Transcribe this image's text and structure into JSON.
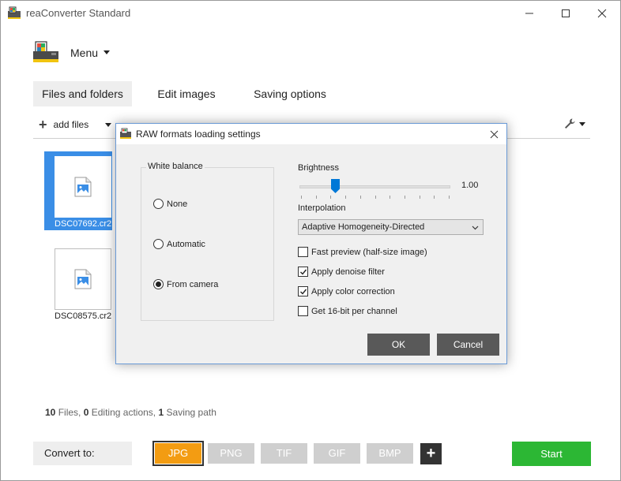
{
  "window": {
    "title": "reaConverter Standard"
  },
  "menu": {
    "label": "Menu"
  },
  "tabs": [
    {
      "label": "Files and folders"
    },
    {
      "label": "Edit images"
    },
    {
      "label": "Saving options"
    }
  ],
  "toolbar": {
    "add_files_label": "add files",
    "settings_icon": "wrench-icon"
  },
  "files": [
    {
      "name": "DSC07692.cr2",
      "selected": true
    },
    {
      "name": "DSC08575.cr2",
      "selected": false
    }
  ],
  "status": {
    "files_count": "10",
    "files_label": "Files,",
    "editing_count": "0",
    "editing_label": "Editing actions,",
    "saving_count": "1",
    "saving_label": "Saving path"
  },
  "bottom": {
    "convert_to_label": "Convert to:",
    "formats": [
      "JPG",
      "PNG",
      "TIF",
      "GIF",
      "BMP"
    ],
    "selected_format": "JPG",
    "add_format_label": "+",
    "start_label": "Start"
  },
  "dialog": {
    "title": "RAW formats loading settings",
    "white_balance": {
      "legend": "White balance",
      "options": [
        "None",
        "Automatic",
        "From camera"
      ],
      "selected": "From camera"
    },
    "brightness": {
      "label": "Brightness",
      "value": "1.00",
      "position": 0.23
    },
    "interpolation": {
      "label": "Interpolation",
      "value": "Adaptive Homogeneity-Directed"
    },
    "checkboxes": [
      {
        "label": "Fast preview (half-size image)",
        "checked": false
      },
      {
        "label": "Apply denoise filter",
        "checked": true
      },
      {
        "label": "Apply color correction",
        "checked": true
      },
      {
        "label": "Get 16-bit per channel",
        "checked": false
      }
    ],
    "ok_label": "OK",
    "cancel_label": "Cancel"
  },
  "colors": {
    "accent_selected": "#3a8ee6",
    "format_active": "#f39c12",
    "format_inactive": "#cfcfcf",
    "start": "#2cb734",
    "dialog_button": "#595959"
  }
}
